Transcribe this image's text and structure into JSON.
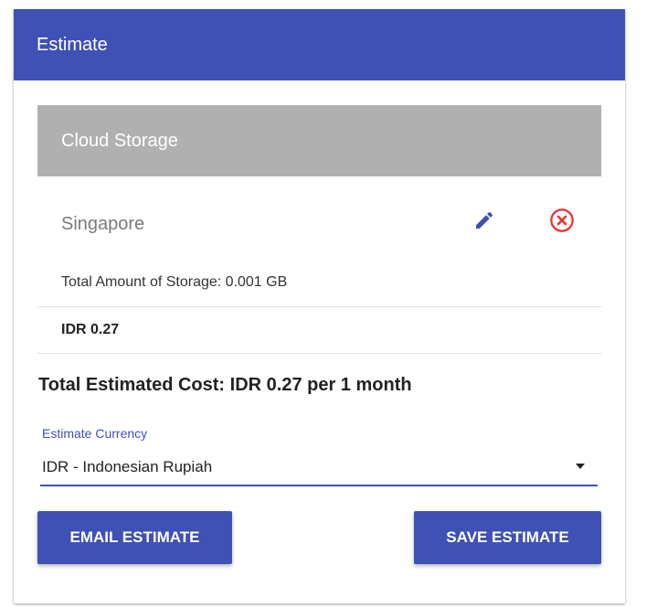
{
  "card": {
    "title": "Estimate"
  },
  "service": {
    "name": "Cloud Storage",
    "region": "Singapore",
    "storage_line": "Total Amount of Storage: 0.001 GB",
    "item_cost": "IDR 0.27",
    "edit_icon": "pencil-icon",
    "remove_icon": "close-circle-icon"
  },
  "total": {
    "text": "Total Estimated Cost: IDR 0.27 per 1 month"
  },
  "currency": {
    "label": "Estimate Currency",
    "selected": "IDR - Indonesian Rupiah"
  },
  "actions": {
    "email_label": "EMAIL ESTIMATE",
    "save_label": "SAVE ESTIMATE"
  },
  "colors": {
    "primary": "#3f51b5",
    "section_header": "#b0b0b0",
    "danger": "#e53935"
  }
}
